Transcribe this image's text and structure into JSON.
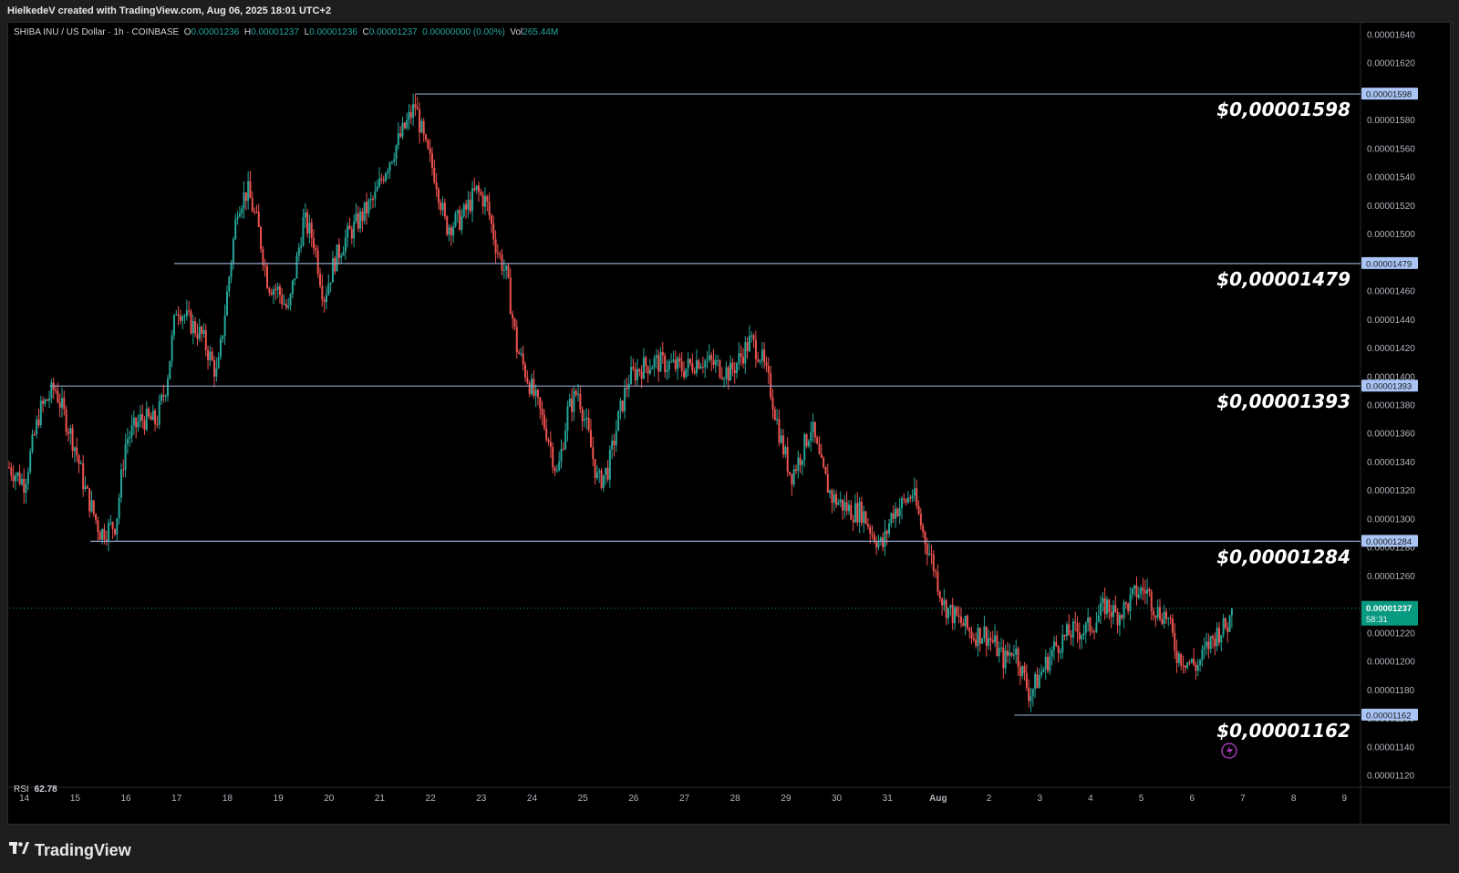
{
  "header": {
    "attribution": "HielkedeV created with TradingView.com, Aug 06, 2025 18:01 UTC+2"
  },
  "legend": {
    "symbol": "SHIBA INU / US Dollar · 1h · COINBASE",
    "open_label": "O",
    "open": "0.00001236",
    "high_label": "H",
    "high": "0.00001237",
    "low_label": "L",
    "low": "0.00001236",
    "close_label": "C",
    "close": "0.00001237",
    "change": "0.00000000 (0.00%)",
    "vol_label": "Vol",
    "vol": "265.44M"
  },
  "indicator": {
    "name": "RSI",
    "value": "62.78"
  },
  "price_tag": {
    "price": "0.00001237",
    "countdown": "58:31",
    "color": "#089981"
  },
  "footer": {
    "brand": "TradingView"
  },
  "colors": {
    "up": "#26a69a",
    "down": "#ef5350",
    "level_line": "#8fa3c8",
    "tag_bg": "#a9c4f5"
  },
  "chart_data": {
    "type": "candlestick",
    "symbol": "SHIBA INU / US Dollar",
    "interval": "1h",
    "exchange": "COINBASE",
    "ylim": [
      1.112e-05,
      1.648e-05
    ],
    "y_ticks": [
      "0.00001640",
      "0.00001620",
      "0.00001600",
      "0.00001580",
      "0.00001560",
      "0.00001540",
      "0.00001520",
      "0.00001500",
      "0.00001480",
      "0.00001460",
      "0.00001440",
      "0.00001420",
      "0.00001400",
      "0.00001380",
      "0.00001360",
      "0.00001340",
      "0.00001320",
      "0.00001300",
      "0.00001280",
      "0.00001260",
      "0.00001240",
      "0.00001220",
      "0.00001200",
      "0.00001180",
      "0.00001160",
      "0.00001140",
      "0.00001120"
    ],
    "x_ticks": [
      "14",
      "15",
      "16",
      "17",
      "18",
      "19",
      "20",
      "21",
      "22",
      "23",
      "24",
      "25",
      "26",
      "27",
      "28",
      "29",
      "30",
      "31",
      "Aug",
      "2",
      "3",
      "4",
      "5",
      "6",
      "7",
      "8",
      "9"
    ],
    "x_tick_days": [
      14,
      15,
      16,
      17,
      18,
      19,
      20,
      21,
      22,
      23,
      24,
      25,
      26,
      27,
      28,
      29,
      30,
      31,
      32,
      33,
      34,
      35,
      36,
      37,
      38,
      39,
      40
    ],
    "x_range_days": [
      13.7,
      40.3
    ],
    "price_path": [
      [
        13.7,
        1336
      ],
      [
        14.0,
        1325
      ],
      [
        14.3,
        1375
      ],
      [
        14.6,
        1392
      ],
      [
        15.0,
        1350
      ],
      [
        15.2,
        1320
      ],
      [
        15.5,
        1290
      ],
      [
        15.8,
        1296
      ],
      [
        16.0,
        1355
      ],
      [
        16.3,
        1370
      ],
      [
        16.6,
        1368
      ],
      [
        16.8,
        1395
      ],
      [
        17.0,
        1450
      ],
      [
        17.2,
        1440
      ],
      [
        17.5,
        1428
      ],
      [
        17.8,
        1400
      ],
      [
        18.0,
        1460
      ],
      [
        18.2,
        1520
      ],
      [
        18.4,
        1530
      ],
      [
        18.6,
        1505
      ],
      [
        18.8,
        1465
      ],
      [
        19.0,
        1460
      ],
      [
        19.2,
        1445
      ],
      [
        19.5,
        1510
      ],
      [
        19.7,
        1495
      ],
      [
        19.9,
        1455
      ],
      [
        20.1,
        1480
      ],
      [
        20.3,
        1495
      ],
      [
        20.6,
        1510
      ],
      [
        20.9,
        1525
      ],
      [
        21.1,
        1545
      ],
      [
        21.3,
        1560
      ],
      [
        21.5,
        1575
      ],
      [
        21.7,
        1590
      ],
      [
        21.9,
        1560
      ],
      [
        22.1,
        1540
      ],
      [
        22.3,
        1505
      ],
      [
        22.6,
        1510
      ],
      [
        22.9,
        1530
      ],
      [
        23.1,
        1522
      ],
      [
        23.3,
        1490
      ],
      [
        23.5,
        1470
      ],
      [
        23.7,
        1420
      ],
      [
        23.9,
        1400
      ],
      [
        24.1,
        1380
      ],
      [
        24.3,
        1360
      ],
      [
        24.5,
        1330
      ],
      [
        24.7,
        1375
      ],
      [
        24.9,
        1390
      ],
      [
        25.1,
        1360
      ],
      [
        25.3,
        1325
      ],
      [
        25.5,
        1335
      ],
      [
        25.7,
        1370
      ],
      [
        25.9,
        1398
      ],
      [
        26.1,
        1405
      ],
      [
        26.4,
        1410
      ],
      [
        26.7,
        1408
      ],
      [
        27.0,
        1405
      ],
      [
        27.3,
        1412
      ],
      [
        27.6,
        1408
      ],
      [
        27.9,
        1402
      ],
      [
        28.1,
        1413
      ],
      [
        28.3,
        1425
      ],
      [
        28.5,
        1415
      ],
      [
        28.7,
        1390
      ],
      [
        28.9,
        1355
      ],
      [
        29.1,
        1330
      ],
      [
        29.3,
        1345
      ],
      [
        29.5,
        1365
      ],
      [
        29.7,
        1335
      ],
      [
        29.9,
        1315
      ],
      [
        30.1,
        1310
      ],
      [
        30.3,
        1305
      ],
      [
        30.5,
        1305
      ],
      [
        30.7,
        1290
      ],
      [
        30.9,
        1280
      ],
      [
        31.1,
        1305
      ],
      [
        31.3,
        1310
      ],
      [
        31.5,
        1318
      ],
      [
        31.7,
        1290
      ],
      [
        31.9,
        1268
      ],
      [
        32.1,
        1240
      ],
      [
        32.3,
        1232
      ],
      [
        32.5,
        1225
      ],
      [
        32.7,
        1218
      ],
      [
        32.9,
        1220
      ],
      [
        33.1,
        1212
      ],
      [
        33.3,
        1200
      ],
      [
        33.5,
        1210
      ],
      [
        33.8,
        1176
      ],
      [
        34.0,
        1190
      ],
      [
        34.3,
        1210
      ],
      [
        34.6,
        1220
      ],
      [
        34.9,
        1222
      ],
      [
        35.1,
        1228
      ],
      [
        35.3,
        1240
      ],
      [
        35.5,
        1232
      ],
      [
        35.7,
        1238
      ],
      [
        35.9,
        1248
      ],
      [
        36.1,
        1250
      ],
      [
        36.3,
        1235
      ],
      [
        36.5,
        1232
      ],
      [
        36.7,
        1205
      ],
      [
        36.9,
        1200
      ],
      [
        37.1,
        1196
      ],
      [
        37.3,
        1210
      ],
      [
        37.5,
        1220
      ],
      [
        37.7,
        1225
      ],
      [
        37.8,
        1237
      ]
    ],
    "price_path_scale": 1e-08,
    "last_price": 1.237e-05,
    "levels": [
      {
        "price": "0.00001598",
        "label": "$0,00001598",
        "start_day": 21.7
      },
      {
        "price": "0.00001479",
        "label": "$0,00001479",
        "start_day": 16.95
      },
      {
        "price": "0.00001393",
        "label": "$0,00001393",
        "start_day": 14.5
      },
      {
        "price": "0.00001284",
        "label": "$0,00001284",
        "start_day": 15.3
      },
      {
        "price": "0.00001162",
        "label": "$0,00001162",
        "start_day": 33.5
      }
    ],
    "grid": false
  }
}
